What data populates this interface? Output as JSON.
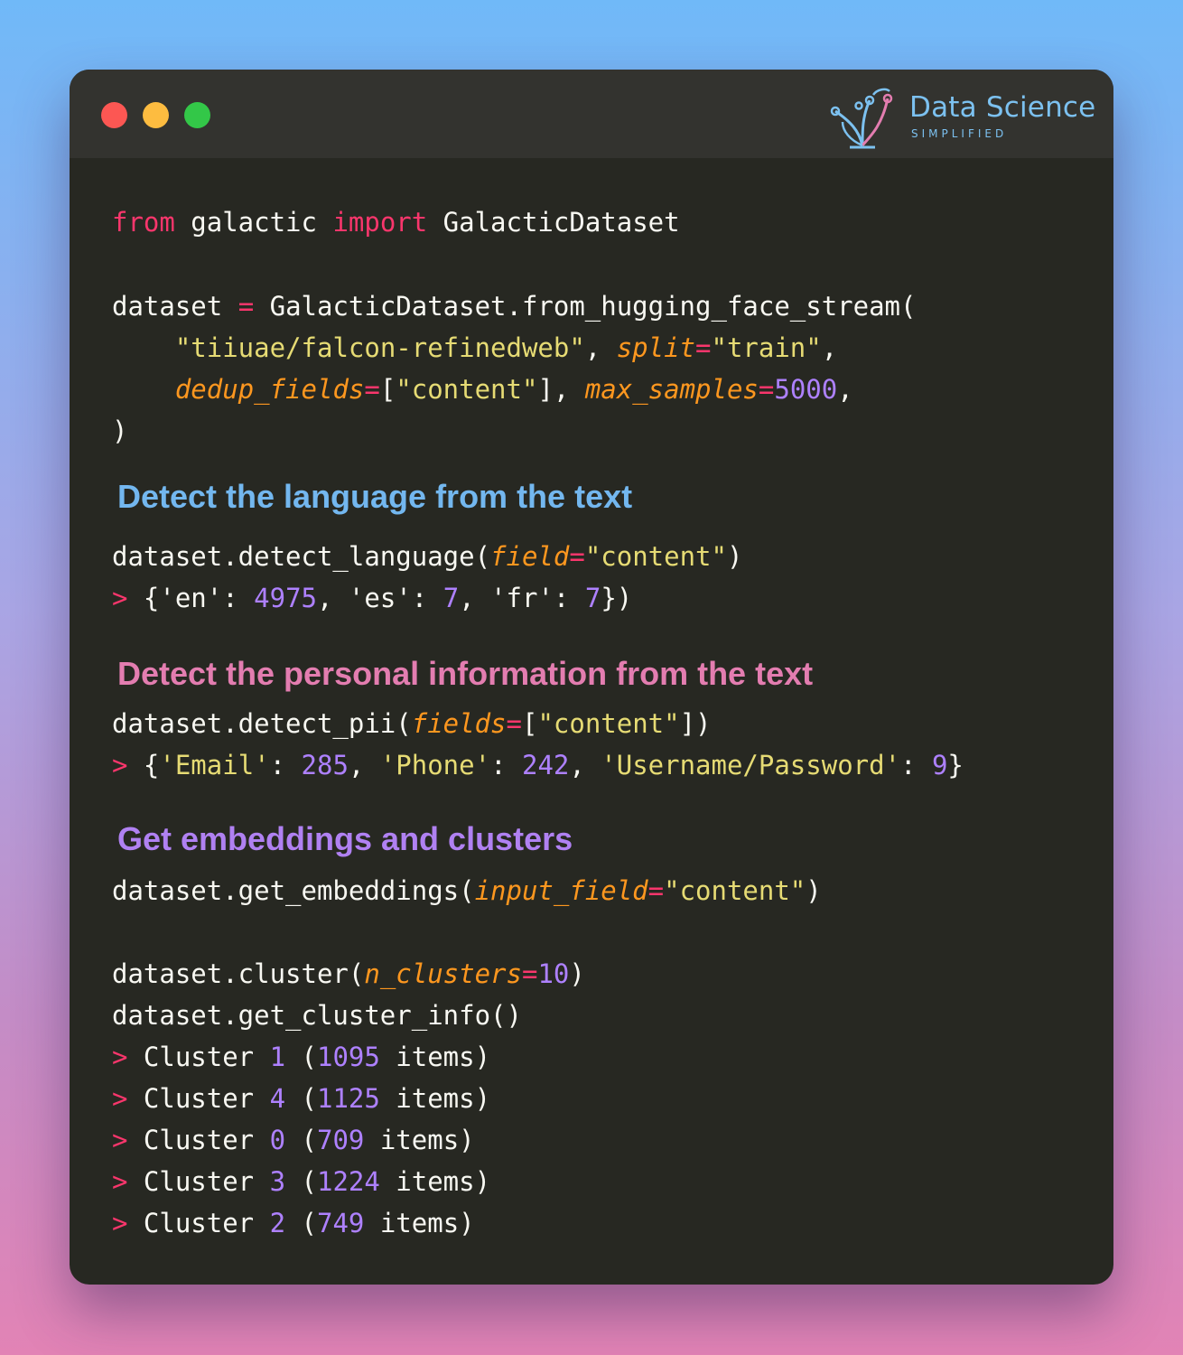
{
  "window": {
    "logo": {
      "title": "Data Science",
      "subtitle": "SIMPLIFIED"
    }
  },
  "colors": {
    "keyword": "#f9366c",
    "param": "#fd971f",
    "string": "#e6db74",
    "number": "#ae81ff",
    "text": "#f8f8f2",
    "heading_language": "#73b7ef",
    "heading_pii": "#e37db0",
    "heading_embeddings": "#b081f2"
  },
  "code": {
    "import": {
      "kw_from": "from",
      "module": " galactic ",
      "kw_import": "import",
      "name": " GalacticDataset"
    },
    "load": {
      "l1_a": "dataset ",
      "l1_eq": "=",
      "l1_b": " GalacticDataset.from_hugging_face_stream(",
      "l2_indent": "    ",
      "l2_repo": "\"tiiuae/falcon-refinedweb\"",
      "l2_comma": ", ",
      "l2_param": "split",
      "l2_eq": "=",
      "l2_val": "\"train\"",
      "l2_end": ",",
      "l3_indent": "    ",
      "l3_param": "dedup_fields",
      "l3_eq": "=",
      "l3_open": "[",
      "l3_val": "\"content\"",
      "l3_close": "], ",
      "l3_param2": "max_samples",
      "l3_eq2": "=",
      "l3_num": "5000",
      "l3_end": ",",
      "l4": ")"
    },
    "language": {
      "heading": "Detect the language from the text",
      "call_a": "dataset.detect_language(",
      "call_param": "field",
      "call_eq": "=",
      "call_val": "\"content\"",
      "call_end": ")",
      "out_prompt": ">",
      "out_a": " {'en': ",
      "out_n1": "4975",
      "out_b": ", 'es': ",
      "out_n2": "7",
      "out_c": ", 'fr': ",
      "out_n3": "7",
      "out_d": "})"
    },
    "pii": {
      "heading": "Detect the personal information from the text",
      "call_a": "dataset.detect_pii(",
      "call_param": "fields",
      "call_eq": "=",
      "call_open": "[",
      "call_val": "\"content\"",
      "call_end": "])",
      "out_prompt": ">",
      "out_a": " {",
      "out_k1": "'Email'",
      "out_s1": ": ",
      "out_n1": "285",
      "out_s2": ", ",
      "out_k2": "'Phone'",
      "out_s3": ": ",
      "out_n2": "242",
      "out_s4": ", ",
      "out_k3": "'Username/Password'",
      "out_s5": ": ",
      "out_n3": "9",
      "out_end": "}"
    },
    "embeddings": {
      "heading": "Get embeddings and clusters",
      "emb_a": "dataset.get_embeddings(",
      "emb_param": "input_field",
      "emb_eq": "=",
      "emb_val": "\"content\"",
      "emb_end": ")",
      "cl_a": "dataset.cluster(",
      "cl_param": "n_clusters",
      "cl_eq": "=",
      "cl_num": "10",
      "cl_end": ")",
      "info": "dataset.get_cluster_info()",
      "clusters": [
        {
          "prompt": ">",
          "label": " Cluster ",
          "id": "1",
          "open": " (",
          "count": "1095",
          "close": " items)"
        },
        {
          "prompt": ">",
          "label": " Cluster ",
          "id": "4",
          "open": " (",
          "count": "1125",
          "close": " items)"
        },
        {
          "prompt": ">",
          "label": " Cluster ",
          "id": "0",
          "open": " (",
          "count": "709",
          "close": " items)"
        },
        {
          "prompt": ">",
          "label": " Cluster ",
          "id": "3",
          "open": " (",
          "count": "1224",
          "close": " items)"
        },
        {
          "prompt": ">",
          "label": " Cluster ",
          "id": "2",
          "open": " (",
          "count": "749",
          "close": " items)"
        }
      ]
    }
  }
}
